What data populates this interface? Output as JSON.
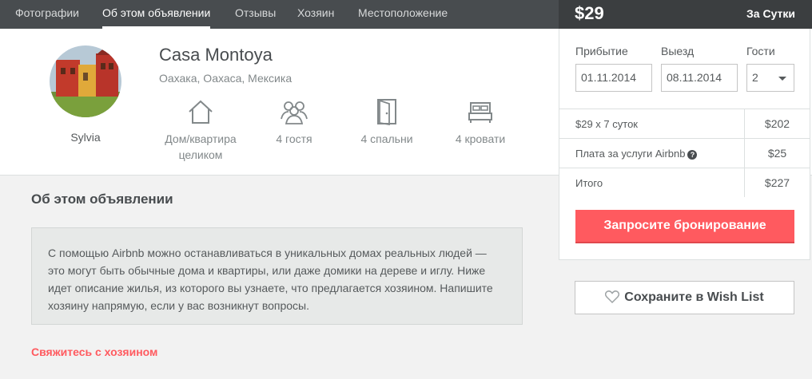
{
  "nav": {
    "tabs": [
      {
        "label": "Фотографии",
        "active": false
      },
      {
        "label": "Об этом объявлении",
        "active": true
      },
      {
        "label": "Отзывы",
        "active": false
      },
      {
        "label": "Хозяин",
        "active": false
      },
      {
        "label": "Местоположение",
        "active": false
      }
    ]
  },
  "host": {
    "name": "Sylvia"
  },
  "listing": {
    "title": "Casa Montoya",
    "location": "Оахака, Оахаса, Мексика",
    "features": [
      {
        "icon": "house-icon",
        "label": "Дом/квартира целиком"
      },
      {
        "icon": "guests-icon",
        "label": "4 гостя"
      },
      {
        "icon": "door-icon",
        "label": "4 спальни"
      },
      {
        "icon": "bed-icon",
        "label": "4 кровати"
      }
    ]
  },
  "about": {
    "title": "Об этом объявлении",
    "text": "С помощью Airbnb можно останавливаться в уникальных домах реальных людей — это могут быть обычные дома и квартиры, или даже домики на дереве и иглу. Ниже идет описание жилья, из которого вы узнаете, что предлагается хозяином. Напишите хозяину напрямую, если у вас возникнут вопросы.",
    "contact_link": "Свяжитесь с хозяином"
  },
  "booking": {
    "price": "$29",
    "period": "За Сутки",
    "checkin_label": "Прибытие",
    "checkin_value": "01.11.2014",
    "checkout_label": "Выезд",
    "checkout_value": "08.11.2014",
    "guests_label": "Гости",
    "guests_value": "2",
    "rows": [
      {
        "label": "$29 x 7 суток",
        "value": "$202"
      },
      {
        "label": "Плата за услуги Airbnb",
        "value": "$25"
      },
      {
        "label": "Итого",
        "value": "$227"
      }
    ],
    "help_glyph": "?",
    "book_button": "Запросите бронирование",
    "wishlist_button": "Сохраните в Wish List"
  },
  "colors": {
    "accent": "#ff5a5f",
    "nav_bg": "#484c4f",
    "price_header_bg": "#3b3e40"
  }
}
